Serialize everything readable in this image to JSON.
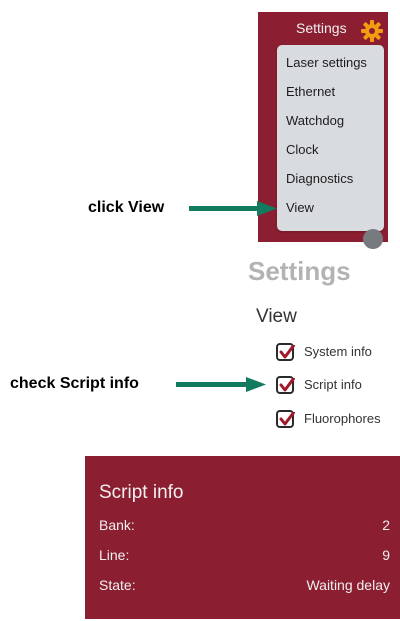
{
  "settings_menu": {
    "header_label": "Settings",
    "icon": "gear-icon",
    "items": [
      {
        "label": "Laser settings"
      },
      {
        "label": "Ethernet"
      },
      {
        "label": "Watchdog"
      },
      {
        "label": "Clock"
      },
      {
        "label": "Diagnostics"
      },
      {
        "label": "View"
      }
    ]
  },
  "callouts": {
    "click_view": "click View",
    "check_script": "check Script info"
  },
  "settings_page": {
    "title": "Settings",
    "section": "View",
    "checkboxes": [
      {
        "label": "System info",
        "checked": true
      },
      {
        "label": "Script info",
        "checked": true
      },
      {
        "label": "Fluorophores",
        "checked": true
      }
    ]
  },
  "script_info": {
    "title": "Script info",
    "rows": [
      {
        "key": "Bank:",
        "value": "2"
      },
      {
        "key": "Line:",
        "value": "9"
      },
      {
        "key": "State:",
        "value": "Waiting delay"
      }
    ]
  },
  "colors": {
    "panel": "#8b1e30",
    "gear": "#f39c12",
    "arrow": "#117a5f",
    "checkmark": "#a3192c"
  }
}
